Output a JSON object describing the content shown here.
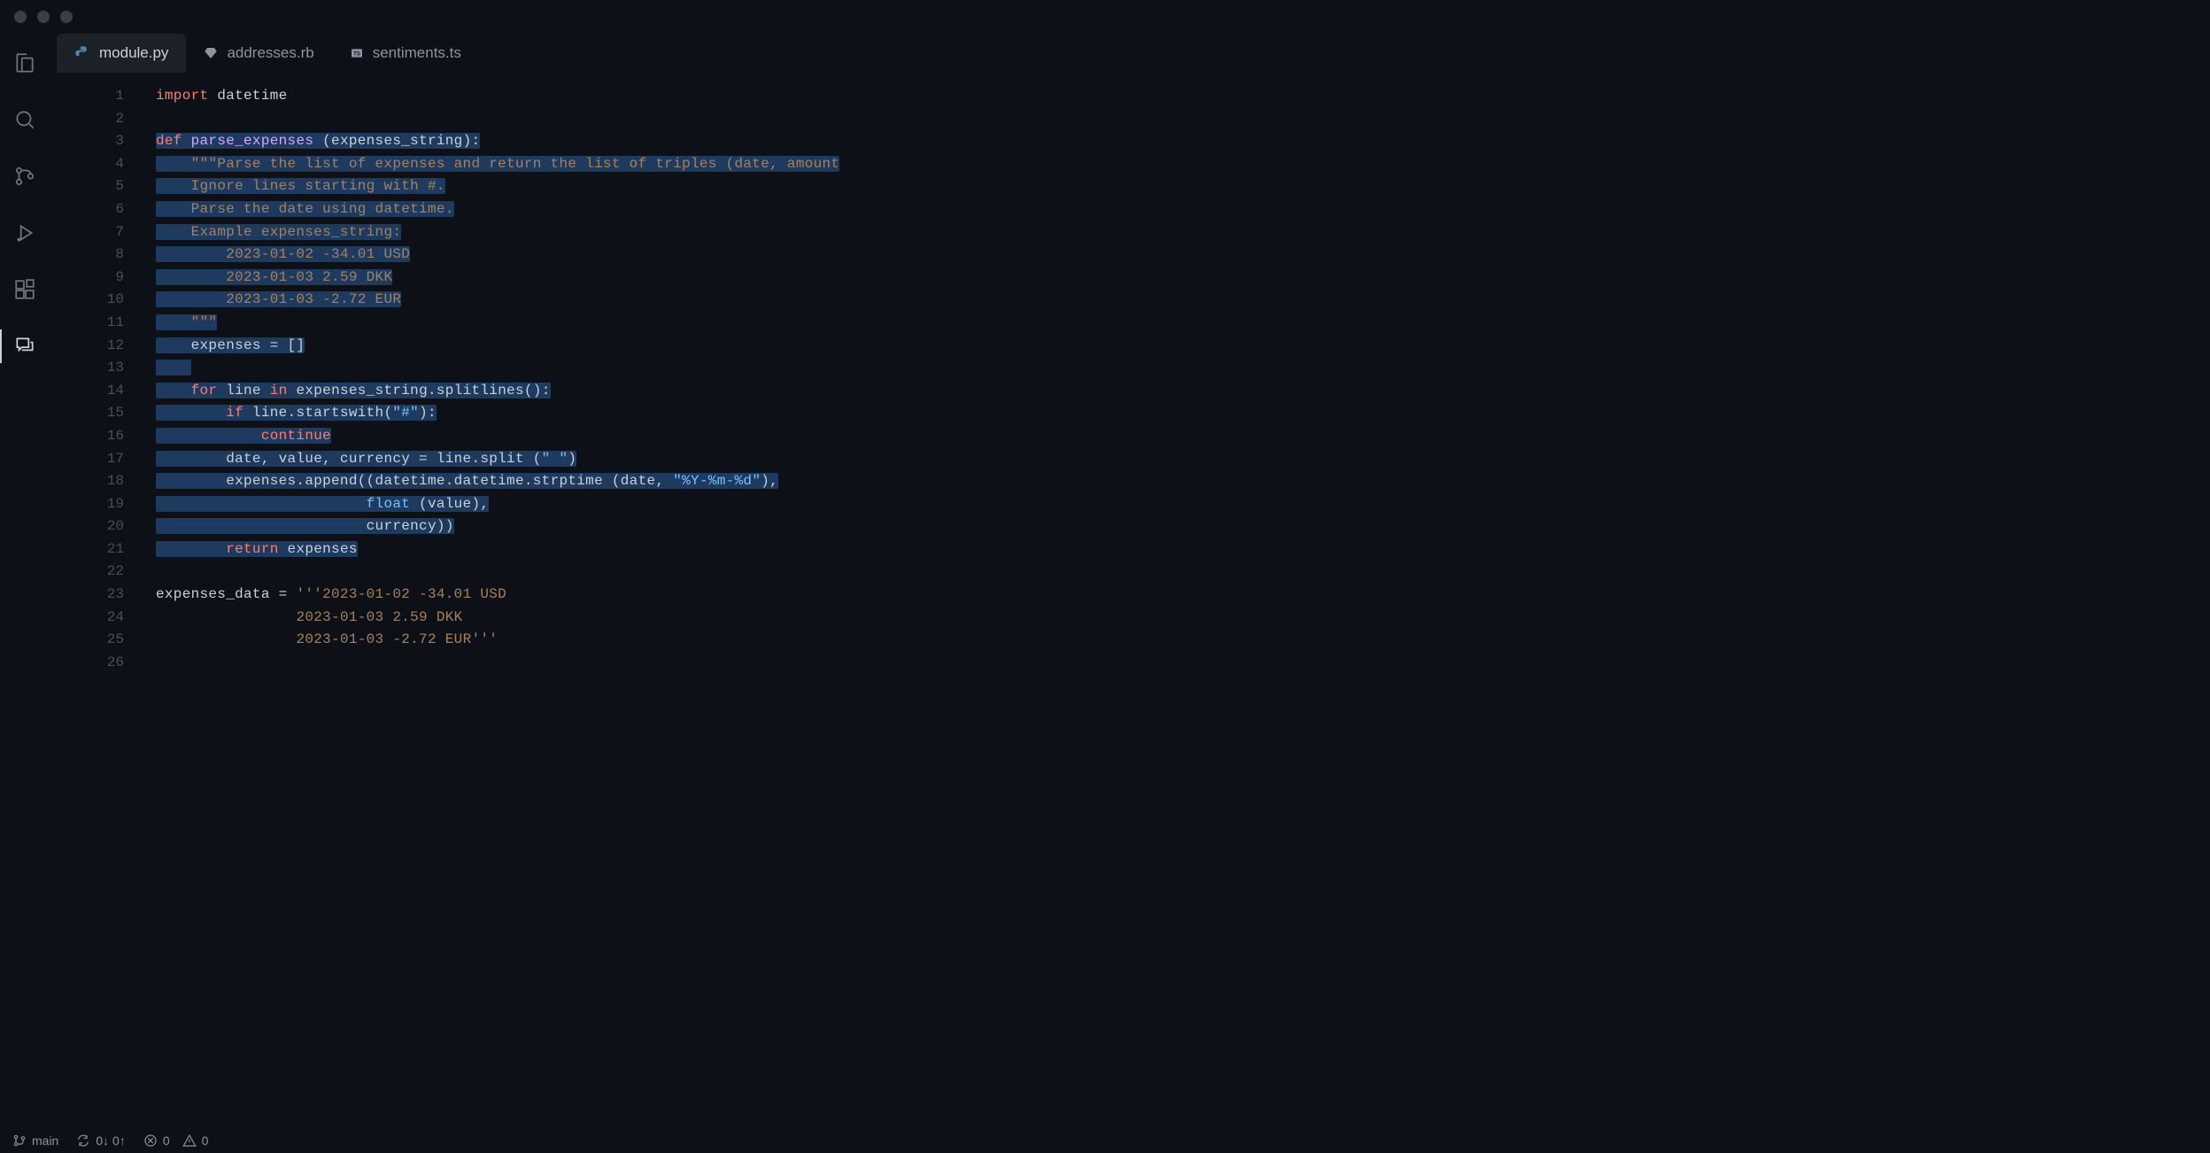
{
  "tabs": [
    {
      "label": "module.py",
      "icon": "python",
      "active": true
    },
    {
      "label": "addresses.rb",
      "icon": "ruby",
      "active": false
    },
    {
      "label": "sentiments.ts",
      "icon": "ts",
      "active": false
    }
  ],
  "code": {
    "lines": [
      {
        "n": 1,
        "sel": false,
        "tokens": [
          [
            "kw",
            "import"
          ],
          [
            "ident",
            " datetime"
          ]
        ]
      },
      {
        "n": 2,
        "sel": false,
        "tokens": []
      },
      {
        "n": 3,
        "sel": true,
        "tokens": [
          [
            "kw",
            "def"
          ],
          [
            "ident",
            " "
          ],
          [
            "fn",
            "parse_expenses"
          ],
          [
            "ident",
            " (expenses_string):"
          ]
        ]
      },
      {
        "n": 4,
        "sel": true,
        "tokens": [
          [
            "ident",
            "    "
          ],
          [
            "str",
            "\"\"\"Parse the list of expenses and return the list of triples (date, amount"
          ]
        ]
      },
      {
        "n": 5,
        "sel": true,
        "tokens": [
          [
            "ident",
            "    "
          ],
          [
            "str",
            "Ignore lines starting with #."
          ]
        ]
      },
      {
        "n": 6,
        "sel": true,
        "tokens": [
          [
            "ident",
            "    "
          ],
          [
            "str",
            "Parse the date using datetime."
          ]
        ]
      },
      {
        "n": 7,
        "sel": true,
        "tokens": [
          [
            "ident",
            "    "
          ],
          [
            "str",
            "Example expenses_string:"
          ]
        ]
      },
      {
        "n": 8,
        "sel": true,
        "tokens": [
          [
            "ident",
            "        "
          ],
          [
            "str",
            "2023-01-02 -34.01 USD"
          ]
        ]
      },
      {
        "n": 9,
        "sel": true,
        "tokens": [
          [
            "ident",
            "        "
          ],
          [
            "str",
            "2023-01-03 2.59 DKK"
          ]
        ]
      },
      {
        "n": 10,
        "sel": true,
        "tokens": [
          [
            "ident",
            "        "
          ],
          [
            "str",
            "2023-01-03 -2.72 EUR"
          ]
        ]
      },
      {
        "n": 11,
        "sel": true,
        "tokens": [
          [
            "ident",
            "    "
          ],
          [
            "str",
            "\"\"\""
          ]
        ]
      },
      {
        "n": 12,
        "sel": true,
        "tokens": [
          [
            "ident",
            "    expenses = []"
          ]
        ]
      },
      {
        "n": 13,
        "sel": true,
        "tokens": [
          [
            "ident",
            "    "
          ]
        ]
      },
      {
        "n": 14,
        "sel": true,
        "tokens": [
          [
            "ident",
            "    "
          ],
          [
            "kw",
            "for"
          ],
          [
            "ident",
            " line "
          ],
          [
            "kw",
            "in"
          ],
          [
            "ident",
            " expenses_string.splitlines():"
          ]
        ]
      },
      {
        "n": 15,
        "sel": true,
        "tokens": [
          [
            "ident",
            "        "
          ],
          [
            "kw",
            "if"
          ],
          [
            "ident",
            " line.startswith("
          ],
          [
            "str2",
            "\"#\""
          ],
          [
            "ident",
            "):"
          ]
        ]
      },
      {
        "n": 16,
        "sel": true,
        "tokens": [
          [
            "ident",
            "            "
          ],
          [
            "kw",
            "continue"
          ]
        ]
      },
      {
        "n": 17,
        "sel": true,
        "tokens": [
          [
            "ident",
            "        date, value, currency = line.split ("
          ],
          [
            "str2",
            "\" \""
          ],
          [
            "ident",
            ")"
          ]
        ]
      },
      {
        "n": 18,
        "sel": true,
        "tokens": [
          [
            "ident",
            "        expenses.append((datetime.datetime.strptime (date, "
          ],
          [
            "str2",
            "\"%Y-%m-%d\""
          ],
          [
            "ident",
            "),"
          ]
        ]
      },
      {
        "n": 19,
        "sel": true,
        "tokens": [
          [
            "ident",
            "                        "
          ],
          [
            "builtin",
            "float"
          ],
          [
            "ident",
            " (value),"
          ]
        ]
      },
      {
        "n": 20,
        "sel": true,
        "tokens": [
          [
            "ident",
            "                        currency))"
          ]
        ]
      },
      {
        "n": 21,
        "sel": true,
        "tokens": [
          [
            "ident",
            "        "
          ],
          [
            "kw",
            "return"
          ],
          [
            "ident",
            " expenses"
          ]
        ]
      },
      {
        "n": 22,
        "sel": false,
        "tokens": []
      },
      {
        "n": 23,
        "sel": false,
        "tokens": [
          [
            "ident",
            "expenses_data = "
          ],
          [
            "str",
            "'''2023-01-02 -34.01 USD"
          ]
        ]
      },
      {
        "n": 24,
        "sel": false,
        "tokens": [
          [
            "ident",
            "                "
          ],
          [
            "str",
            "2023-01-03 2.59 DKK"
          ]
        ]
      },
      {
        "n": 25,
        "sel": false,
        "tokens": [
          [
            "ident",
            "                "
          ],
          [
            "str",
            "2023-01-03 -2.72 EUR'''"
          ]
        ]
      },
      {
        "n": 26,
        "sel": false,
        "tokens": []
      }
    ]
  },
  "statusbar": {
    "branch": "main",
    "sync": "0↓ 0↑",
    "errors": "0",
    "warnings": "0"
  }
}
